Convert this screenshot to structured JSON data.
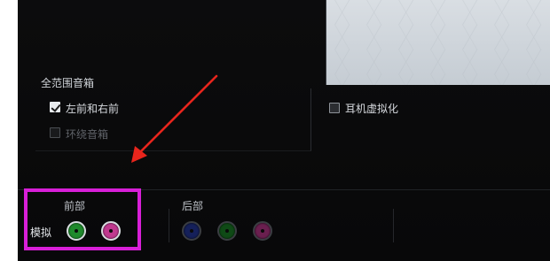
{
  "speaker_section": {
    "title": "全范围音箱",
    "options": [
      {
        "label": "左前和右前",
        "checked": true,
        "enabled": true
      },
      {
        "label": "环绕音箱",
        "checked": false,
        "enabled": false
      }
    ]
  },
  "headphone_option": {
    "label": "耳机虚拟化",
    "checked": false
  },
  "analog_label": "模拟",
  "front_panel": {
    "label": "前部",
    "jacks": [
      {
        "name": "green-jack",
        "color": "#1f8a2c",
        "state": "active"
      },
      {
        "name": "pink-jack",
        "color": "#c0398f",
        "state": "active"
      }
    ]
  },
  "rear_panel": {
    "label": "后部",
    "jacks": [
      {
        "name": "blue-jack",
        "color": "#15205a",
        "state": "dim"
      },
      {
        "name": "green-jack",
        "color": "#0f4a16",
        "state": "dim"
      },
      {
        "name": "pink-jack",
        "color": "#6a1f4f",
        "state": "dim"
      }
    ]
  },
  "annotation": {
    "highlight_color": "#d81fd8",
    "arrow_color": "#e8251c"
  }
}
